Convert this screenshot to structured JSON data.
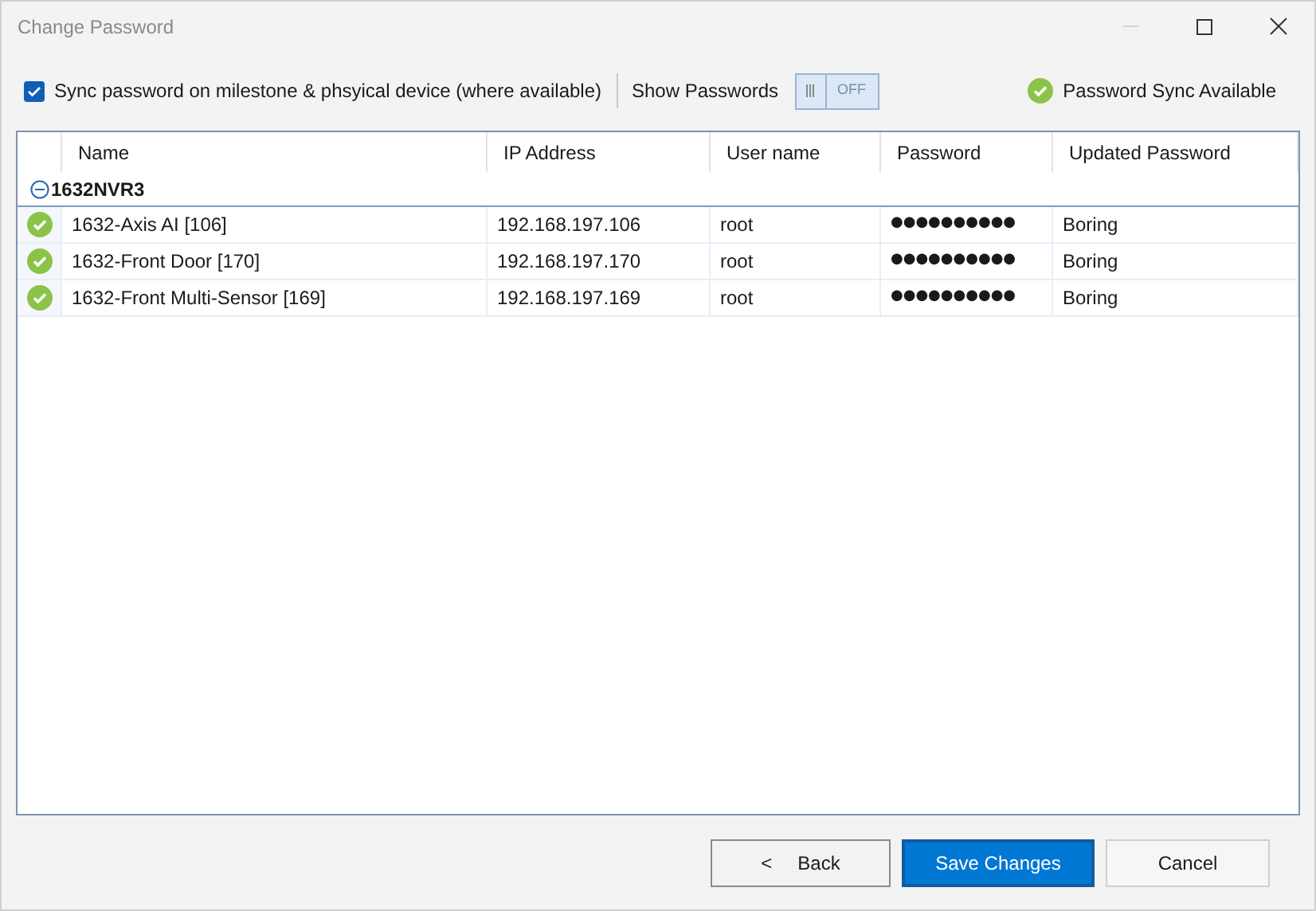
{
  "window": {
    "title": "Change Password",
    "minimize_disabled": true
  },
  "toolbar": {
    "sync": {
      "label": "Sync password on milestone & phsyical device (where available)",
      "checked": true
    },
    "show_passwords": {
      "label": "Show Passwords",
      "on": false,
      "state_text": "OFF"
    },
    "status": "Password Sync Available"
  },
  "table": {
    "columns": [
      "Name",
      "IP Address",
      "User name",
      "Password",
      "Updated Password"
    ],
    "groups": [
      {
        "name": "1632NVR3",
        "expanded": true,
        "rows": [
          {
            "name": "1632-Axis AI [106]",
            "ip": "192.168.197.106",
            "user": "root",
            "password": "●●●●●●●●●●",
            "updated": "Boring",
            "ok": true,
            "selected": false
          },
          {
            "name": "1632-Front Door [170]",
            "ip": "192.168.197.170",
            "user": "root",
            "password": "●●●●●●●●●●",
            "updated": "Boring",
            "ok": true,
            "selected": false
          },
          {
            "name": "1632-Front Multi-Sensor [169]",
            "ip": "192.168.197.169",
            "user": "root",
            "password": "●●●●●●●●●●",
            "updated": "Boring",
            "ok": true,
            "selected": false
          }
        ]
      }
    ]
  },
  "buttons": {
    "back": {
      "icon": "<",
      "label": "Back"
    },
    "save": "Save Changes",
    "cancel": "Cancel"
  }
}
